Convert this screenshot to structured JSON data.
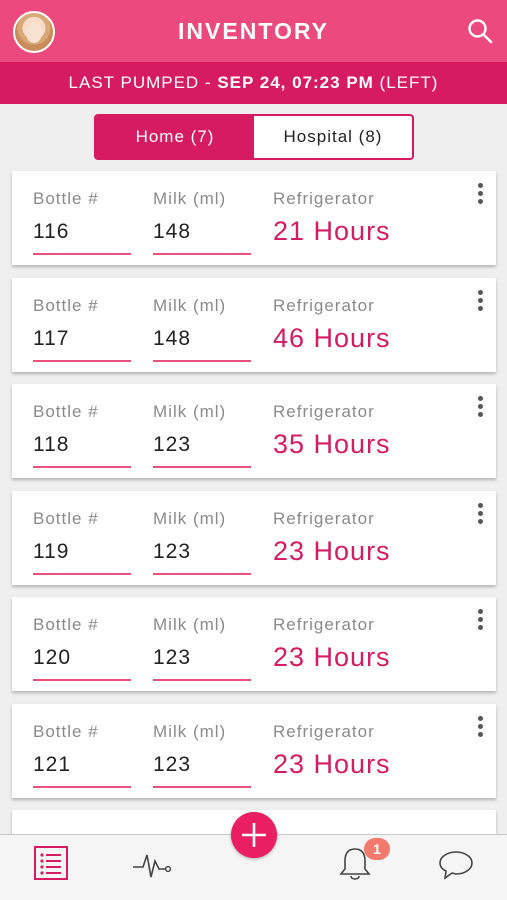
{
  "header": {
    "title": "INVENTORY"
  },
  "subheader": {
    "prefix": "LAST PUMPED - ",
    "datetime": "SEP 24, 07:23 PM",
    "suffix": " (LEFT)"
  },
  "tabs": [
    {
      "label": "Home (7)",
      "active": true
    },
    {
      "label": "Hospital (8)",
      "active": false
    }
  ],
  "columns": {
    "bottle": "Bottle #",
    "milk": "Milk (ml)",
    "storage": "Refrigerator"
  },
  "rows": [
    {
      "bottle": "116",
      "milk": "148",
      "hours": "21 Hours"
    },
    {
      "bottle": "117",
      "milk": "148",
      "hours": "46 Hours"
    },
    {
      "bottle": "118",
      "milk": "123",
      "hours": "35 Hours"
    },
    {
      "bottle": "119",
      "milk": "123",
      "hours": "23 Hours"
    },
    {
      "bottle": "120",
      "milk": "123",
      "hours": "23 Hours"
    },
    {
      "bottle": "121",
      "milk": "123",
      "hours": "23 Hours"
    }
  ],
  "tabbar": {
    "items": [
      "list-icon",
      "activity-icon",
      "add-button",
      "bell-icon",
      "chat-icon"
    ],
    "notification_count": "1"
  },
  "colors": {
    "primary": "#ec4a7f",
    "primary_dark": "#d61b62",
    "badge": "#f47a6e"
  }
}
